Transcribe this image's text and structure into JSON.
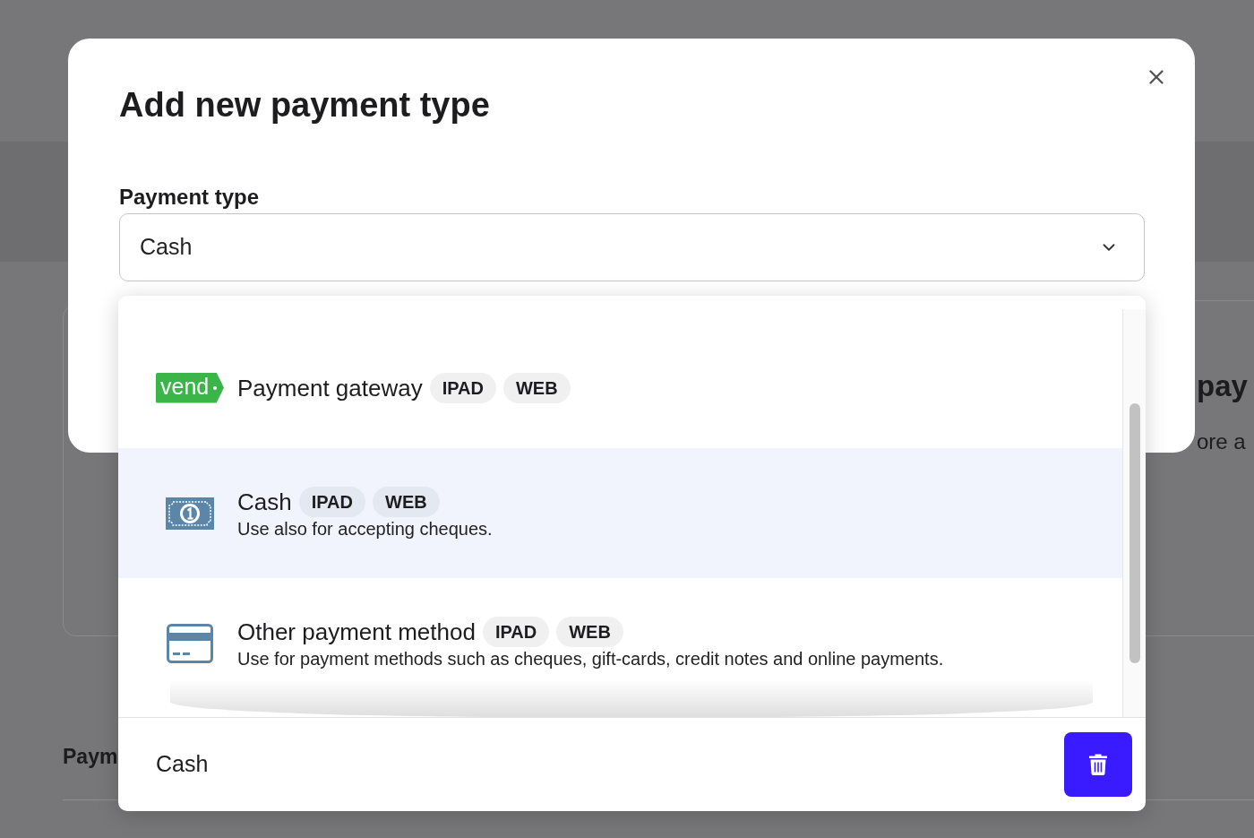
{
  "page": {
    "section": {
      "heading": "pay",
      "text": "ore a"
    },
    "list": {
      "heading": "Paym"
    }
  },
  "dialog": {
    "title": "Add new payment type",
    "field": {
      "label": "Payment type",
      "value": "Cash",
      "expanded": true
    },
    "dropdown": {
      "options": [
        {
          "kind": "logo",
          "logo_text": "vend",
          "name": "Payment gateway",
          "tags": [
            "IPAD",
            "WEB"
          ],
          "selected": false
        },
        {
          "kind": "cash",
          "name": "Cash",
          "tags": [
            "IPAD",
            "WEB"
          ],
          "description": "Use also for accepting cheques.",
          "selected": true
        },
        {
          "kind": "card",
          "name": "Other payment method",
          "tags": [
            "IPAD",
            "WEB"
          ],
          "description": "Use for payment methods such as cheques, gift-cards, credit notes and online payments.",
          "selected": false
        }
      ],
      "footer": {
        "label": "Cash"
      }
    }
  }
}
